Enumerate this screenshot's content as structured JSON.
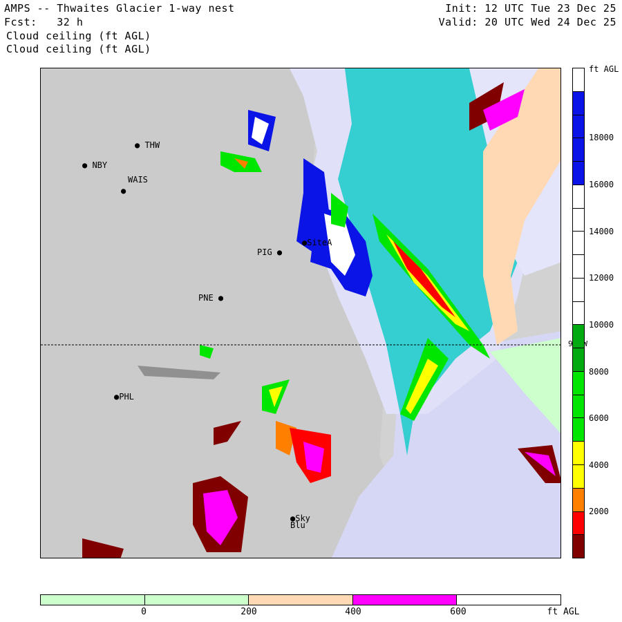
{
  "header": {
    "title": "AMPS -- Thwaites Glacier 1-way nest",
    "forecast": "Fcst:   32 h",
    "field_line1": "Cloud ceiling (ft AGL)",
    "field_line2": "Cloud ceiling (ft AGL)",
    "init": "Init: 12 UTC Tue 23 Dec 25",
    "valid": "Valid: 20 UTC Wed 24 Dec 25"
  },
  "stations": [
    "THW",
    "NBY",
    "WAIS",
    "SiteA",
    "PIG",
    "PNE",
    "PHL",
    "Sky Blu"
  ],
  "meridian_label": "90 W",
  "colorbar_vertical": {
    "unit": "ft AGL",
    "labels": [
      "18000",
      "16000",
      "14000",
      "12000",
      "10000",
      "8000",
      "6000",
      "4000",
      "2000"
    ],
    "colors": [
      "#ffffff",
      "#0a14e6",
      "#0a14e6",
      "#0a14e6",
      "#0a14e6",
      "#ffffff",
      "#ffffff",
      "#ffffff",
      "#ffffff",
      "#ffffff",
      "#ffffff",
      "#00aa10",
      "#00aa10",
      "#00e600",
      "#00e600",
      "#00e600",
      "#ffff00",
      "#ffff00",
      "#ff8000",
      "#ff0000",
      "#800000"
    ]
  },
  "colorbar_horizontal": {
    "unit": "ft AGL",
    "labels": [
      "0",
      "200",
      "400",
      "600"
    ],
    "colors": [
      "#ccffcc",
      "#ccffcc",
      "#ffd9b3",
      "#ff00ff",
      "#ffffff"
    ]
  }
}
